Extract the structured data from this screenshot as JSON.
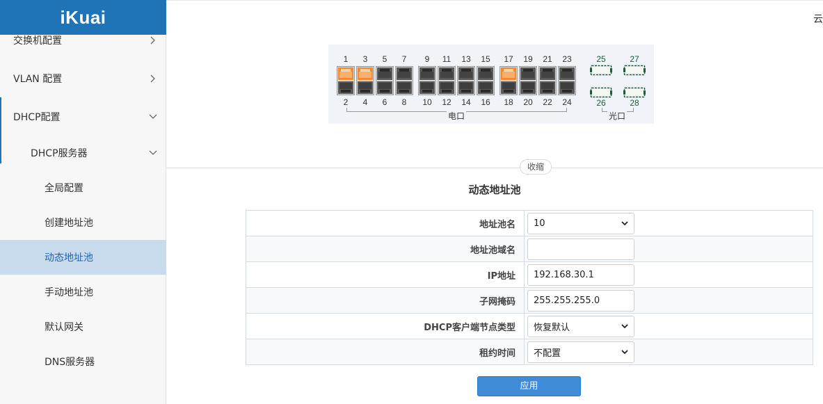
{
  "brand": {
    "logo": "iKuai",
    "bg_color": "#1f74b8"
  },
  "sidebar": {
    "items": [
      {
        "label": "交换机配置",
        "arrow": "chevron-right"
      },
      {
        "label": "VLAN 配置",
        "arrow": "chevron-right"
      },
      {
        "label": "DHCP配置",
        "arrow": "chevron-down"
      },
      {
        "label": "DHCP服务器",
        "arrow": "chevron-down"
      },
      {
        "label": "全局配置"
      },
      {
        "label": "创建地址池"
      },
      {
        "label": "动态地址池",
        "active": true
      },
      {
        "label": "手动地址池"
      },
      {
        "label": "默认网关"
      },
      {
        "label": "DNS服务器"
      }
    ],
    "active_color": "#c7dbec"
  },
  "header": {
    "top_right_text": "云"
  },
  "switch_panel": {
    "top_ports": [
      "1",
      "3",
      "5",
      "7",
      "9",
      "11",
      "13",
      "15",
      "17",
      "19",
      "21",
      "23"
    ],
    "bottom_ports": [
      "2",
      "4",
      "6",
      "8",
      "10",
      "12",
      "14",
      "16",
      "18",
      "20",
      "22",
      "24"
    ],
    "active_ports_top": [
      "1",
      "3",
      "17"
    ],
    "optic_top": [
      "25",
      "27"
    ],
    "optic_bottom": [
      "26",
      "28"
    ],
    "electric_label": "电口",
    "optic_label": "光口",
    "active_color": "#f28a2e"
  },
  "collapse_label": "收缩",
  "form": {
    "title": "动态地址池",
    "rows": [
      {
        "label": "地址池名",
        "type": "select",
        "value": "10"
      },
      {
        "label": "地址池域名",
        "type": "input",
        "value": ""
      },
      {
        "label": "IP地址",
        "type": "input",
        "value": "192.168.30.1"
      },
      {
        "label": "子网掩码",
        "type": "input",
        "value": "255.255.255.0"
      },
      {
        "label": "DHCP客户端节点类型",
        "type": "select",
        "value": "恢复默认"
      },
      {
        "label": "租约时间",
        "type": "select",
        "value": "不配置"
      }
    ],
    "apply_label": "应用",
    "apply_color": "#3f8bd6"
  }
}
